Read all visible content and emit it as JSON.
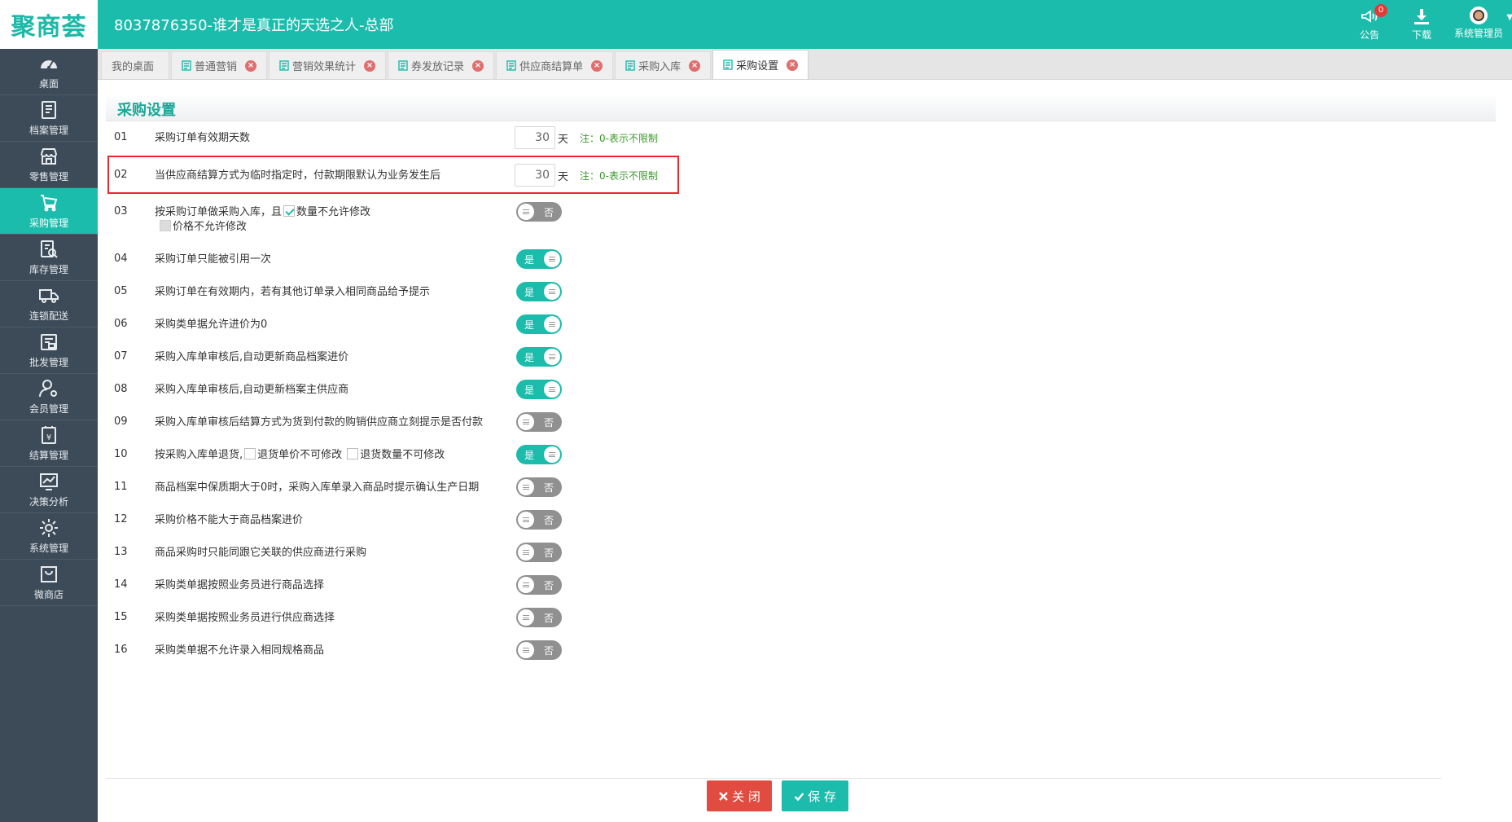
{
  "header": {
    "logo_text": "聚商荟",
    "title": "8037876350-谁才是真正的天选之人-总部",
    "notice_label": "公告",
    "notice_count": "0",
    "download_label": "下载",
    "user_label": "系统管理员"
  },
  "sidebar": {
    "items": [
      {
        "label": "桌面",
        "icon": "dashboard-icon"
      },
      {
        "label": "档案管理",
        "icon": "archive-icon"
      },
      {
        "label": "零售管理",
        "icon": "store-icon"
      },
      {
        "label": "采购管理",
        "icon": "cart-icon",
        "active": true
      },
      {
        "label": "库存管理",
        "icon": "inventory-icon"
      },
      {
        "label": "连锁配送",
        "icon": "truck-icon"
      },
      {
        "label": "批发管理",
        "icon": "wholesale-icon"
      },
      {
        "label": "会员管理",
        "icon": "member-icon"
      },
      {
        "label": "结算管理",
        "icon": "settlement-icon"
      },
      {
        "label": "决策分析",
        "icon": "chart-icon"
      },
      {
        "label": "系统管理",
        "icon": "gear-icon"
      },
      {
        "label": "微商店",
        "icon": "shop-bag-icon"
      }
    ]
  },
  "tabs": [
    {
      "label": "我的桌面"
    },
    {
      "label": "普通营销"
    },
    {
      "label": "营销效果统计"
    },
    {
      "label": "券发放记录"
    },
    {
      "label": "供应商结算单"
    },
    {
      "label": "采购入库"
    },
    {
      "label": "采购设置",
      "active": true
    }
  ],
  "page": {
    "title": "采购设置",
    "unit_day": "天",
    "note": "注：0-表示不限制",
    "on_label": "是",
    "off_label": "否"
  },
  "settings": {
    "r01": {
      "num": "01",
      "text": "采购订单有效期天数",
      "value": "30"
    },
    "r02": {
      "num": "02",
      "text": "当供应商结算方式为临时指定时，付款期限默认为业务发生后",
      "value": "30"
    },
    "r03": {
      "num": "03",
      "text_a": "按采购订单做采购入库，且",
      "opt1": "数量不允许修改",
      "opt2": "价格不允许修改",
      "on": false
    },
    "r04": {
      "num": "04",
      "text": "采购订单只能被引用一次",
      "on": true
    },
    "r05": {
      "num": "05",
      "text": "采购订单在有效期内，若有其他订单录入相同商品给予提示",
      "on": true
    },
    "r06": {
      "num": "06",
      "text": "采购类单据允许进价为0",
      "on": true
    },
    "r07": {
      "num": "07",
      "text": "采购入库单审核后,自动更新商品档案进价",
      "on": true
    },
    "r08": {
      "num": "08",
      "text": "采购入库单审核后,自动更新档案主供应商",
      "on": true
    },
    "r09": {
      "num": "09",
      "text": "采购入库单审核后结算方式为货到付款的购销供应商立刻提示是否付款",
      "on": false
    },
    "r10": {
      "num": "10",
      "text_a": "按采购入库单退货,",
      "opt1": "退货单价不可修改",
      "opt2": "退货数量不可修改",
      "on": true
    },
    "r11": {
      "num": "11",
      "text": "商品档案中保质期大于0时，采购入库单录入商品时提示确认生产日期",
      "on": false
    },
    "r12": {
      "num": "12",
      "text": "采购价格不能大于商品档案进价",
      "on": false
    },
    "r13": {
      "num": "13",
      "text": "商品采购时只能同跟它关联的供应商进行采购",
      "on": false
    },
    "r14": {
      "num": "14",
      "text": "采购类单据按照业务员进行商品选择",
      "on": false
    },
    "r15": {
      "num": "15",
      "text": "采购类单据按照业务员进行供应商选择",
      "on": false
    },
    "r16": {
      "num": "16",
      "text": "采购类单据不允许录入相同规格商品",
      "on": false
    }
  },
  "footer": {
    "close_label": "关 闭",
    "save_label": "保 存"
  },
  "colors": {
    "brand": "#1cbcac",
    "sidebar": "#3d4b59",
    "toggle_off": "#909090",
    "close_button": "#e14b40",
    "highlight": "#e8282e"
  }
}
